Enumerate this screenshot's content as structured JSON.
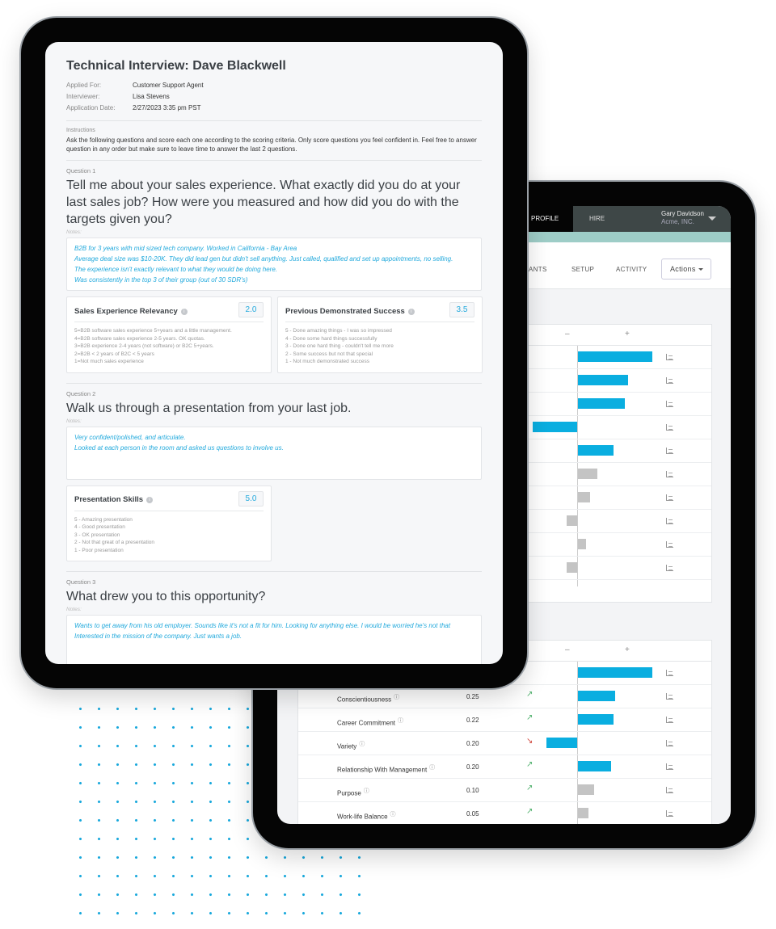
{
  "colors": {
    "accent": "#22a9dc",
    "bar_positive": "#0aaee0",
    "bar_neutral": "#c4c4c4",
    "trend_up": "#4caf6a",
    "trend_down": "#d0443a",
    "topbar": "#3e4747",
    "teal_strip": "#9ecdc7"
  },
  "interview": {
    "title": "Technical Interview: Dave Blackwell",
    "meta": [
      {
        "label": "Applied For:",
        "value": "Customer Support Agent"
      },
      {
        "label": "Interviewer:",
        "value": "Lisa Stevens"
      },
      {
        "label": "Application Date:",
        "value": "2/27/2023 3:35 pm PST"
      }
    ],
    "instructions_label": "Instructions",
    "instructions": "Ask the following questions and score each one according to the scoring criteria. Only score questions you feel confident in. Feel free to answer question in any order but make sure to leave time to answer the last 2 questions.",
    "notes_label": "Notes:",
    "questions": [
      {
        "label": "Question 1",
        "text": "Tell me about your sales experience. What exactly did you do at your last sales job? How were you measured and how did you do with the targets given you?",
        "notes": [
          "B2B for 3 years with mid sized tech company. Worked in California - Bay Area",
          "Average deal size was $10-20K. They did lead gen but didn't sell anything. Just called, qualified and set up appointments, no selling.",
          "The experience isn't exactly relevant to what they would be doing here.",
          "Was consistently in the top 3 of their group (out of 30 SDR's)"
        ],
        "scores": [
          {
            "title": "Sales Experience Relevancy",
            "score": "2.0",
            "criteria": [
              "5=B2B software sales experience 5+years and a little management.",
              "4=B2B software sales experience 2-5 years. OK quotas.",
              "3=B2B experience 2-4 years (not software) or B2C 5+years.",
              "2=B2B < 2 years of B2C < 5 years",
              "1=Not much sales experience"
            ]
          },
          {
            "title": "Previous Demonstrated Success",
            "score": "3.5",
            "criteria": [
              "5 - Done amazing things - I was so impressed",
              "4 - Done some hard things successfully",
              "3 - Done one hard thing - couldn't tell me more",
              "2 - Some success but not that special",
              "1 - Not much demonstrated success"
            ]
          }
        ]
      },
      {
        "label": "Question 2",
        "text": "Walk us through a presentation from your last job.",
        "notes": [
          "Very confident/polished, and articulate.",
          "Looked at each person in the room and asked us questions to involve us."
        ],
        "scores": [
          {
            "title": "Presentation Skills",
            "score": "5.0",
            "criteria": [
              "5 - Amazing presentation",
              "4 - Good presentation",
              "3 - OK presentation",
              "2 - Not that great of a presentation",
              "1 - Poor presentation"
            ]
          }
        ]
      },
      {
        "label": "Question 3",
        "text": "What drew you to this opportunity?",
        "notes": [
          "Wants to get away from his old employer. Sounds like it's not a fit for him. Looking for anything else. I would be worried he's not that",
          "Interested in the mission of the company. Just wants a job."
        ]
      }
    ]
  },
  "profile": {
    "nav": {
      "profile": "PROFILE",
      "hire": "HIRE",
      "user_name": "Gary Davidson",
      "user_company": "Acme, INC."
    },
    "subnav": [
      "PANTS",
      "SETUP",
      "ACTIVITY"
    ],
    "actions_label": "Actions",
    "axis_minus": "–",
    "axis_plus": "+",
    "card1_bars": [
      {
        "value": 1.0,
        "color": "positive"
      },
      {
        "value": 0.67,
        "color": "positive"
      },
      {
        "value": 0.63,
        "color": "positive"
      },
      {
        "value": -0.6,
        "color": "positive"
      },
      {
        "value": 0.48,
        "color": "positive"
      },
      {
        "value": 0.26,
        "color": "neutral"
      },
      {
        "value": 0.16,
        "color": "neutral"
      },
      {
        "value": -0.14,
        "color": "neutral"
      },
      {
        "value": 0.11,
        "color": "neutral"
      },
      {
        "value": -0.14,
        "color": "neutral"
      }
    ],
    "card2_rows": [
      {
        "label": "",
        "number": "",
        "trend": "",
        "value": 1.0,
        "color": "positive"
      },
      {
        "label": "Conscientiousness",
        "number": "0.25",
        "trend": "up",
        "value": 0.5,
        "color": "positive"
      },
      {
        "label": "Career Commitment",
        "number": "0.22",
        "trend": "up",
        "value": 0.48,
        "color": "positive"
      },
      {
        "label": "Variety",
        "number": "0.20",
        "trend": "down",
        "value": -0.41,
        "color": "positive"
      },
      {
        "label": "Relationship With Management",
        "number": "0.20",
        "trend": "up",
        "value": 0.45,
        "color": "positive"
      },
      {
        "label": "Purpose",
        "number": "0.10",
        "trend": "up",
        "value": 0.22,
        "color": "neutral"
      },
      {
        "label": "Work-life Balance",
        "number": "0.05",
        "trend": "up",
        "value": 0.14,
        "color": "neutral"
      }
    ]
  }
}
